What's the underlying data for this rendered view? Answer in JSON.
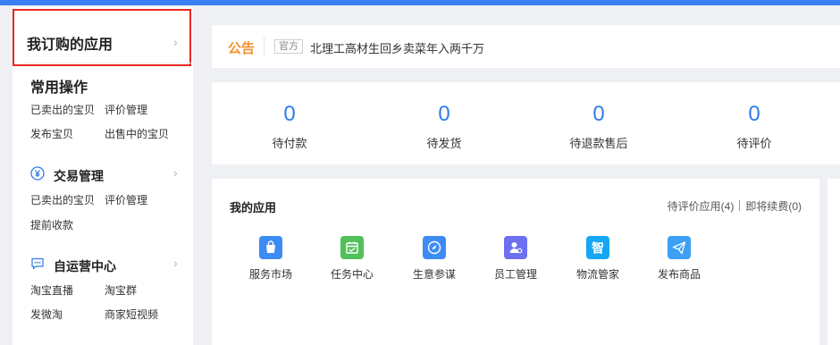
{
  "sidebar": {
    "subscribed_title": "我订购的应用",
    "common_title": "常用操作",
    "common_links": [
      "已卖出的宝贝",
      "评价管理",
      "发布宝贝",
      "出售中的宝贝"
    ],
    "trade": {
      "title": "交易管理",
      "icon": "yen-circle-icon",
      "links": [
        "已卖出的宝贝",
        "评价管理",
        "提前收款"
      ]
    },
    "operation": {
      "title": "自运营中心",
      "icon": "chat-bubble-icon",
      "links": [
        "淘宝直播",
        "淘宝群",
        "发微淘",
        "商家短视频"
      ]
    }
  },
  "notice": {
    "label": "公告",
    "tag": "官方",
    "text": "北理工高材生回乡卖菜年入两千万"
  },
  "stats": [
    {
      "value": "0",
      "label": "待付款"
    },
    {
      "value": "0",
      "label": "待发货"
    },
    {
      "value": "0",
      "label": "待退款售后"
    },
    {
      "value": "0",
      "label": "待评价"
    }
  ],
  "apps": {
    "title": "我的应用",
    "link_pending_review": "待评价应用(4)",
    "link_expiring": "即将续费(0)",
    "items": [
      {
        "label": "服务市场",
        "icon": "shopping-bag-icon",
        "color": "#3d8bf5"
      },
      {
        "label": "任务中心",
        "icon": "calendar-icon",
        "color": "#52c05a"
      },
      {
        "label": "生意参谋",
        "icon": "compass-icon",
        "color": "#3d8bf5"
      },
      {
        "label": "员工管理",
        "icon": "user-settings-icon",
        "color": "#6b6ff0"
      },
      {
        "label": "物流管家",
        "icon": "zhi-icon",
        "color": "#17a6f2"
      },
      {
        "label": "发布商品",
        "icon": "paper-plane-icon",
        "color": "#3da0f5"
      }
    ]
  },
  "colors": {
    "accent": "#2f7ce8",
    "notice": "#f5912d",
    "highlight_border": "#e8281e"
  }
}
